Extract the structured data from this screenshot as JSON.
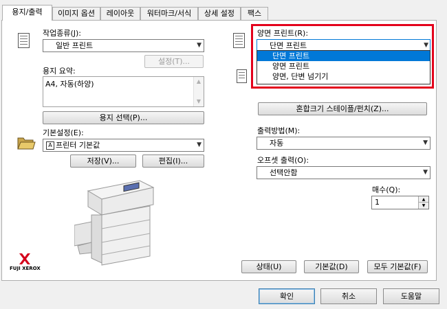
{
  "tabs": [
    {
      "label": "용지/출력",
      "active": true
    },
    {
      "label": "이미지 옵션"
    },
    {
      "label": "레이아웃"
    },
    {
      "label": "워터마크/서식"
    },
    {
      "label": "상세 설정"
    },
    {
      "label": "팩스"
    }
  ],
  "left": {
    "job_type_label": "작업종류(J):",
    "job_type_value": "일반 프린트",
    "settings_button": "설정(T)...",
    "paper_summary_label": "용지 요약:",
    "paper_summary_value": "A4, 자동(하양)",
    "paper_select_button": "용지 선택(P)...",
    "preset_label": "기본설정(E):",
    "preset_value": "프린터 기본값",
    "save_button": "저장(V)...",
    "edit_button": "편집(I)...",
    "brand_text": "FUJI XEROX"
  },
  "right": {
    "duplex_label": "양면 프린트(R):",
    "duplex_value": "단면 프린트",
    "duplex_options": [
      "단면 프린트",
      "양면 프린트",
      "양면, 단변 넘기기"
    ],
    "mixed_size_button": "혼합크기 스테이플/펀치(Z)...",
    "output_method_label": "출력방법(M):",
    "output_method_value": "자동",
    "offset_label": "오프셋 출력(O):",
    "offset_value": "선택안함",
    "copies_label": "매수(Q):",
    "copies_value": "1",
    "status_button": "상태(U)",
    "defaults_button": "기본값(D)",
    "all_defaults_button": "모두 기본값(F)"
  },
  "footer": {
    "ok": "확인",
    "cancel": "취소",
    "help": "도움말"
  },
  "colors": {
    "highlight": "#e3001b",
    "selection": "#0078d7",
    "xerox_red": "#d4001b"
  }
}
